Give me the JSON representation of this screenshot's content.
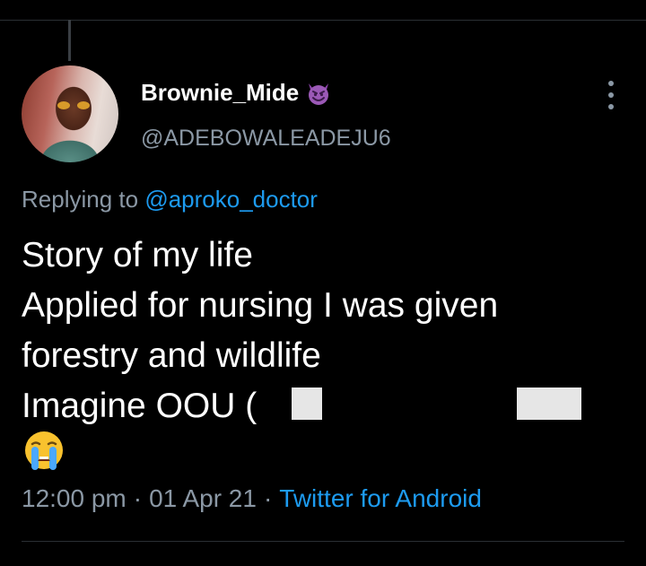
{
  "tweet": {
    "author": {
      "display_name": "Brownie_Mide",
      "handle": "@ADEBOWALEADEJU6",
      "badge_icon": "smiling-devil-emoji"
    },
    "replying_to_prefix": "Replying to",
    "replying_to_handle": "@aproko_doctor",
    "lines": [
      "Story of my life",
      "Applied for nursing I was given",
      "forestry and wildlife",
      "Imagine OOU ("
    ],
    "trailing_emoji": "loudly-crying-face-emoji",
    "time": "12:00 pm",
    "separator": "·",
    "date": "01 Apr 21",
    "source": "Twitter for Android"
  },
  "colors": {
    "background": "#000000",
    "text": "#ffffff",
    "secondary_text": "#8b98a5",
    "link": "#1d9bf0"
  }
}
